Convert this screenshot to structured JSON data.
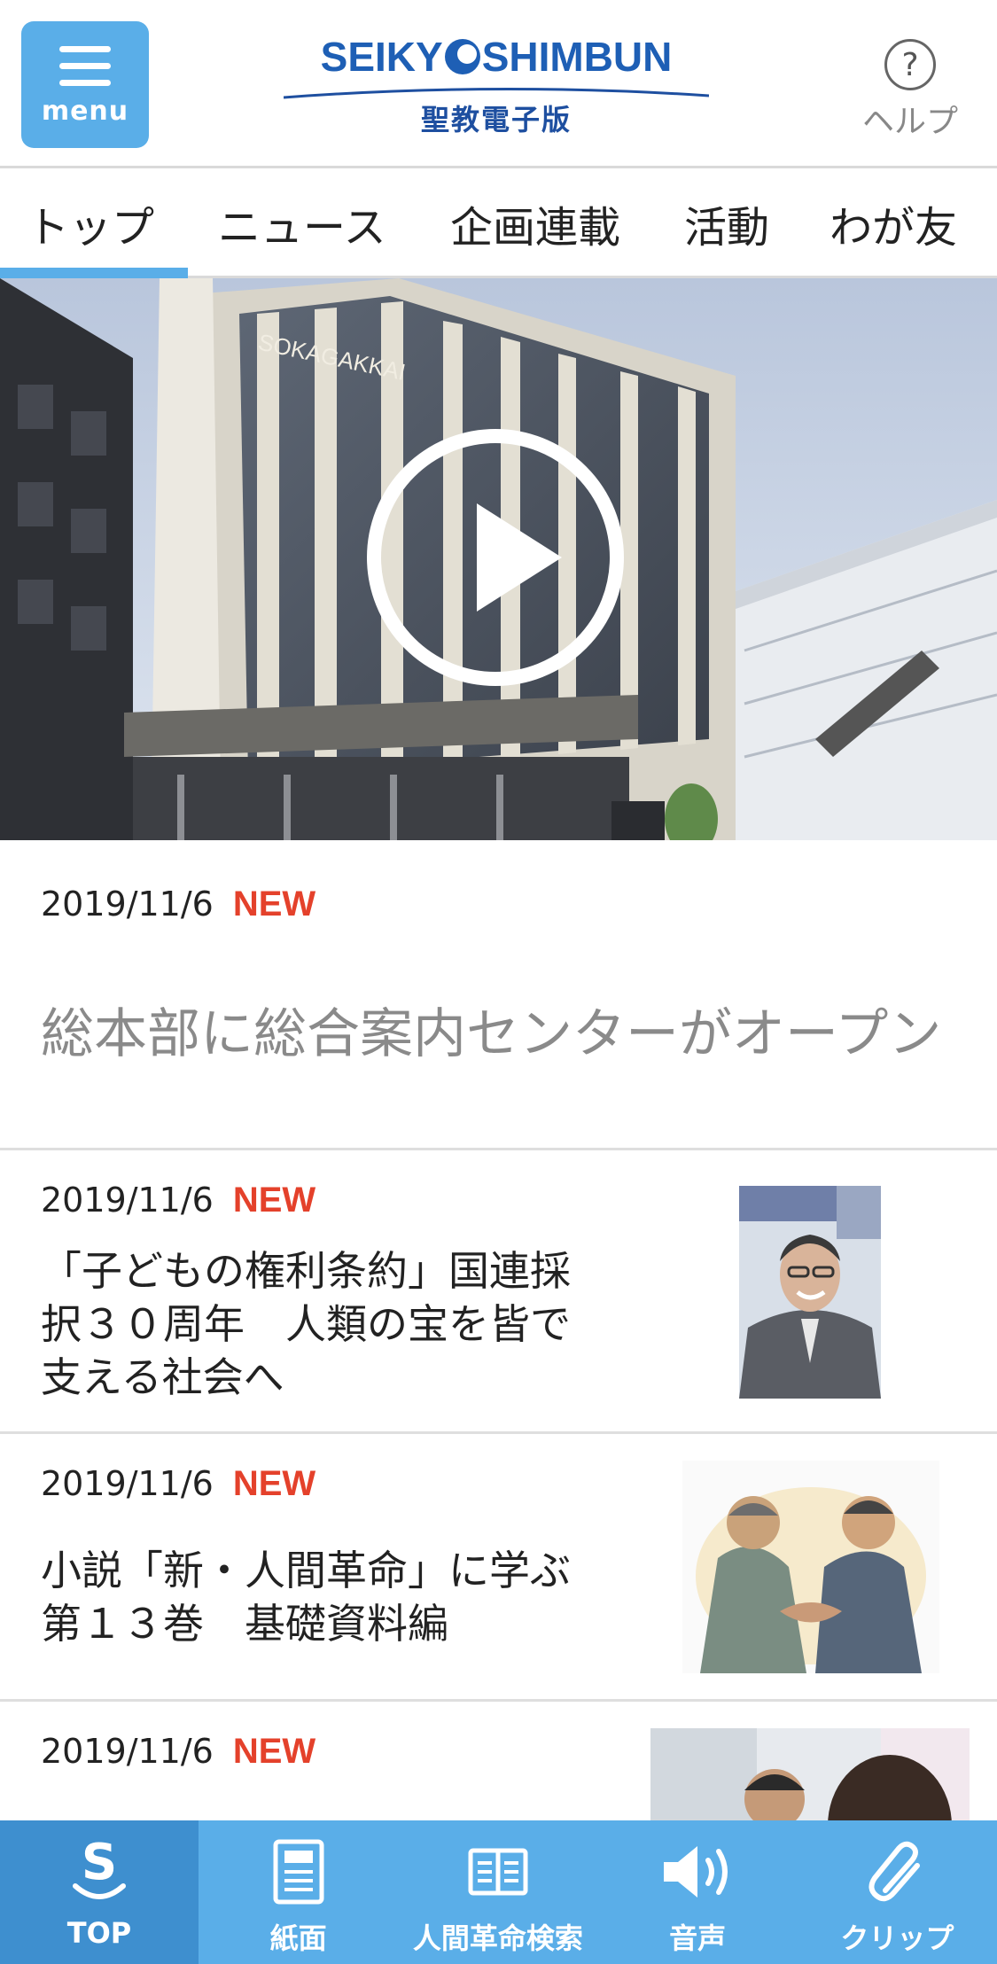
{
  "header": {
    "menu_label": "menu",
    "logo_en_left": "SEIKY",
    "logo_en_right": "SHIMBUN",
    "logo_jp": "聖教電子版",
    "help_symbol": "?",
    "help_label": "ヘルプ"
  },
  "tabs": [
    {
      "label": "トップ",
      "active": true
    },
    {
      "label": "ニュース",
      "active": false
    },
    {
      "label": "企画連載",
      "active": false
    },
    {
      "label": "活動",
      "active": false
    },
    {
      "label": "わが友",
      "active": false
    }
  ],
  "hero": {
    "sign_text": "SOKAGAKKAI"
  },
  "articles": [
    {
      "date": "2019/11/6",
      "badge": "NEW",
      "title": "総本部に総合案内センターがオープン"
    },
    {
      "date": "2019/11/6",
      "badge": "NEW",
      "title_lines": [
        "「子どもの権利条約」国連採",
        "択３０周年　人類の宝を皆で",
        "支える社会へ"
      ]
    },
    {
      "date": "2019/11/6",
      "badge": "NEW",
      "title_lines": [
        "小説「新・人間革命」に学ぶ",
        "第１３巻　基礎資料編"
      ]
    },
    {
      "date": "2019/11/6",
      "badge": "NEW"
    }
  ],
  "bottom_nav": [
    {
      "label": "TOP",
      "icon": "s-logo-icon",
      "active": true
    },
    {
      "label": "紙面",
      "icon": "newspaper-icon",
      "active": false
    },
    {
      "label": "人間革命検索",
      "icon": "book-search-icon",
      "active": false
    },
    {
      "label": "音声",
      "icon": "speaker-icon",
      "active": false
    },
    {
      "label": "クリップ",
      "icon": "paperclip-icon",
      "active": false
    }
  ],
  "colors": {
    "accent": "#5aaee8",
    "brand": "#1e5fb5",
    "new_badge": "#e4412b"
  }
}
